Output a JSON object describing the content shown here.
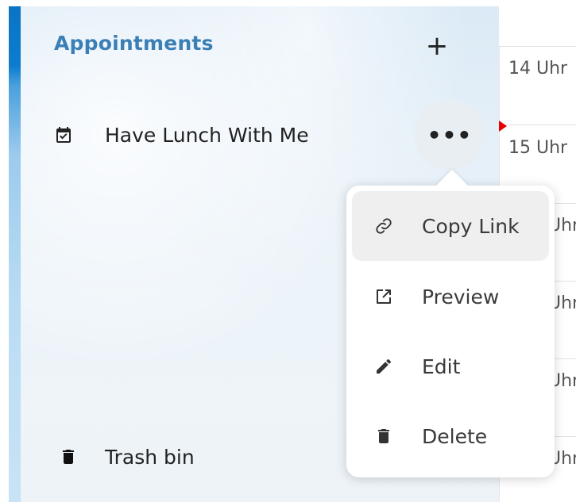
{
  "sidebar": {
    "section_title": "Appointments",
    "add_label": "+",
    "items": [
      {
        "label": "Have Lunch With Me",
        "icon": "calendar-check-icon"
      }
    ],
    "actions_label": "•••",
    "trash": {
      "label": "Trash bin",
      "icon": "trash-icon"
    }
  },
  "calendar": {
    "time_labels": [
      "14 Uhr",
      "15 Uhr",
      "Uhr",
      "Uhr",
      "Uhr",
      "Uhr"
    ],
    "now_marker_color": "#e60000"
  },
  "menu": {
    "items": [
      {
        "label": "Copy Link",
        "icon": "link-icon"
      },
      {
        "label": "Preview",
        "icon": "external-link-icon"
      },
      {
        "label": "Edit",
        "icon": "pencil-icon"
      },
      {
        "label": "Delete",
        "icon": "trash-icon"
      }
    ]
  },
  "colors": {
    "accent": "#3a7fb5",
    "sidebar_edge": "#0a74c4"
  }
}
